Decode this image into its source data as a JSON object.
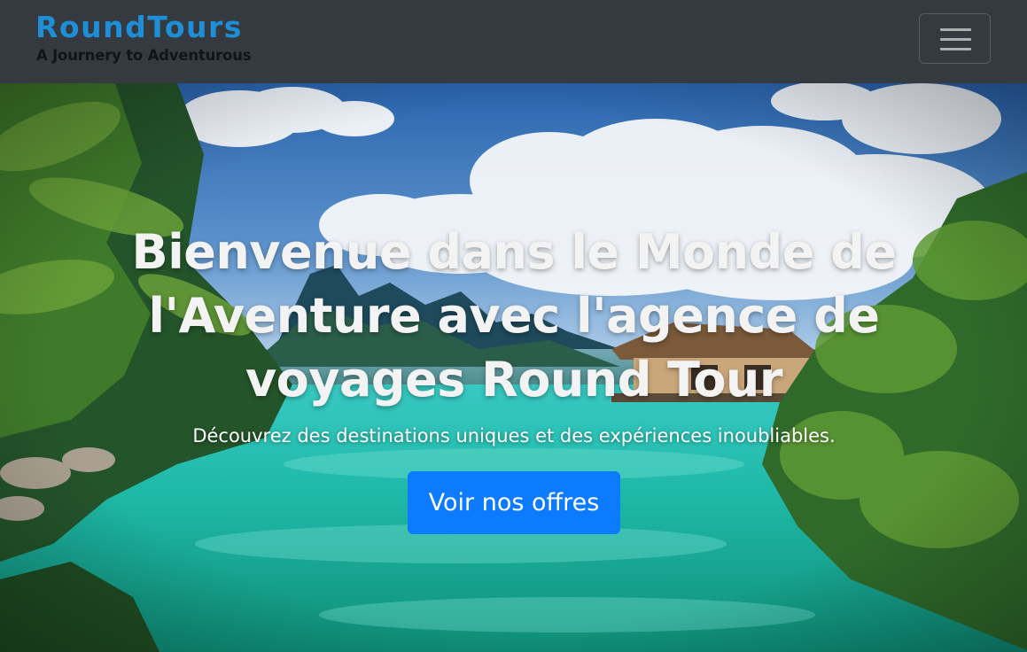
{
  "navbar": {
    "brand_title": "RoundTours",
    "brand_tagline": "A Journery to Adventurous",
    "toggler_icon": "hamburger-menu-icon",
    "background_color": "#343a40",
    "brand_color": "#1e8fd6"
  },
  "hero": {
    "background_image": "tropical-lagoon-landscape",
    "title": "Bienvenue dans le Monde de l'Aventure avec l'agence de voyages Round Tour",
    "subtitle": "Découvrez des destinations uniques et des expériences inoubliables.",
    "cta_label": "Voir nos offres",
    "cta_color": "#0d7bff"
  }
}
